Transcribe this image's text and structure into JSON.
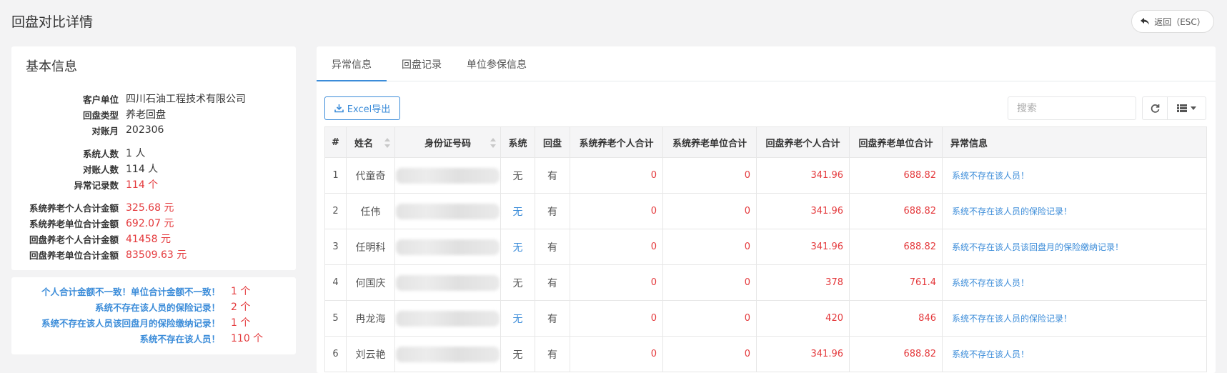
{
  "page": {
    "title": "回盘对比详情",
    "back_label": "返回（ESC）"
  },
  "basic_info": {
    "title": "基本信息",
    "customer_label": "客户单位",
    "customer_value": "四川石油工程技术有限公司",
    "type_label": "回盘类型",
    "type_value": "养老回盘",
    "month_label": "对账月",
    "month_value": "202306",
    "sys_count_label": "系统人数",
    "sys_count_value": "1 人",
    "recon_count_label": "对账人数",
    "recon_count_value": "114 人",
    "abnormal_count_label": "异常记录数",
    "abnormal_count_value": "114 个",
    "sys_personal_label": "系统养老个人合计金额",
    "sys_personal_value": "325.68 元",
    "sys_unit_label": "系统养老单位合计金额",
    "sys_unit_value": "692.07 元",
    "back_personal_label": "回盘养老个人合计金额",
    "back_personal_value": "41458 元",
    "back_unit_label": "回盘养老单位合计金额",
    "back_unit_value": "83509.63 元"
  },
  "summary": [
    {
      "label": "个人合计金额不一致！单位合计金额不一致！",
      "value": "1 个"
    },
    {
      "label": "系统不存在该人员的保险记录！",
      "value": "2 个"
    },
    {
      "label": "系统不存在该人员该回盘月的保险缴纳记录！",
      "value": "1 个"
    },
    {
      "label": "系统不存在该人员！",
      "value": "110 个"
    }
  ],
  "tabs": [
    {
      "label": "异常信息",
      "active": true
    },
    {
      "label": "回盘记录",
      "active": false
    },
    {
      "label": "单位参保信息",
      "active": false
    }
  ],
  "toolbar": {
    "excel_label": "Excel导出",
    "search_placeholder": "搜索"
  },
  "table": {
    "headers": [
      "#",
      "姓名",
      "身份证号码",
      "系统",
      "回盘",
      "系统养老个人合计",
      "系统养老单位合计",
      "回盘养老个人合计",
      "回盘养老单位合计",
      "异常信息"
    ],
    "rows": [
      {
        "idx": "1",
        "name": "代童奇",
        "sys": "无",
        "sys_blue": false,
        "back": "有",
        "sp": "0",
        "su": "0",
        "bp": "341.96",
        "bu": "688.82",
        "err": "系统不存在该人员！"
      },
      {
        "idx": "2",
        "name": "任伟",
        "sys": "无",
        "sys_blue": true,
        "back": "有",
        "sp": "0",
        "su": "0",
        "bp": "341.96",
        "bu": "688.82",
        "err": "系统不存在该人员的保险记录！"
      },
      {
        "idx": "3",
        "name": "任明科",
        "sys": "无",
        "sys_blue": true,
        "back": "有",
        "sp": "0",
        "su": "0",
        "bp": "341.96",
        "bu": "688.82",
        "err": "系统不存在该人员该回盘月的保险缴纳记录！"
      },
      {
        "idx": "4",
        "name": "何国庆",
        "sys": "无",
        "sys_blue": false,
        "back": "有",
        "sp": "0",
        "su": "0",
        "bp": "378",
        "bu": "761.4",
        "err": "系统不存在该人员！"
      },
      {
        "idx": "5",
        "name": "冉龙海",
        "sys": "无",
        "sys_blue": true,
        "back": "有",
        "sp": "0",
        "su": "0",
        "bp": "420",
        "bu": "846",
        "err": "系统不存在该人员的保险记录！"
      },
      {
        "idx": "6",
        "name": "刘云艳",
        "sys": "无",
        "sys_blue": false,
        "back": "有",
        "sp": "0",
        "su": "0",
        "bp": "341.96",
        "bu": "688.82",
        "err": "系统不存在该人员！"
      }
    ]
  }
}
